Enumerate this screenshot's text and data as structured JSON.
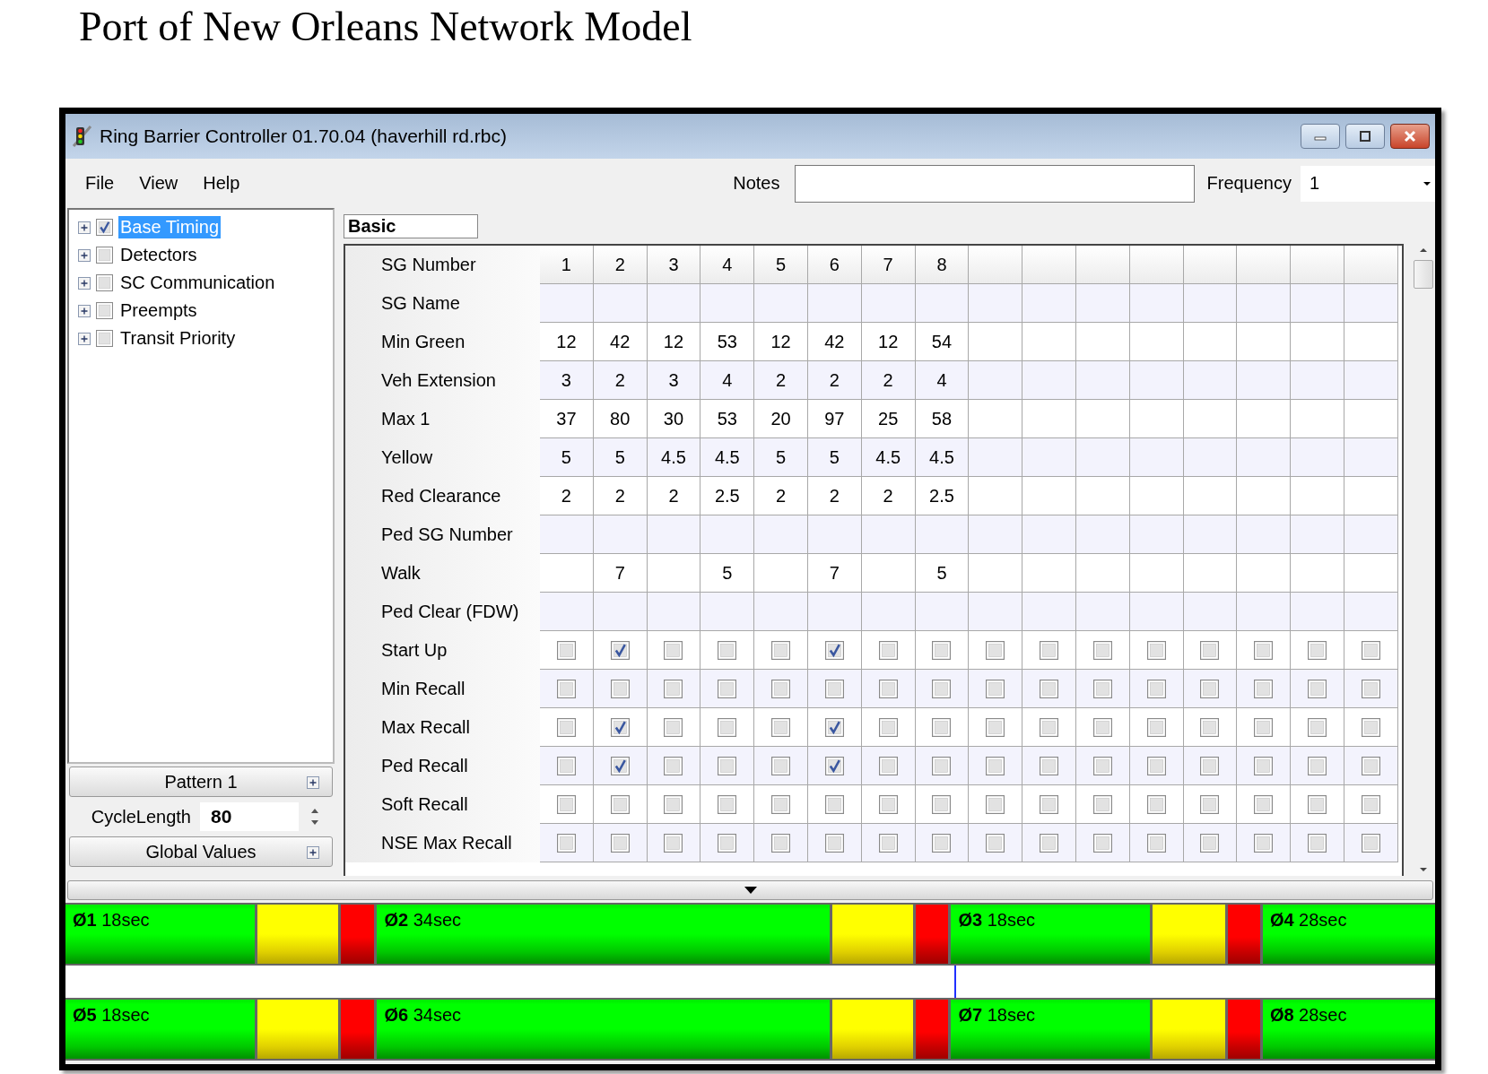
{
  "document_title": "Port of New Orleans Network Model",
  "window": {
    "title": "Ring Barrier Controller 01.70.04 (haverhill rd.rbc)"
  },
  "menu": [
    "File",
    "View",
    "Help"
  ],
  "notes": {
    "label": "Notes"
  },
  "frequency": {
    "label": "Frequency",
    "value": "1"
  },
  "tree": [
    {
      "label": "Base Timing",
      "checked": true,
      "selected": true,
      "expanded": false
    },
    {
      "label": "Detectors",
      "checked": false,
      "selected": false,
      "expanded": false
    },
    {
      "label": "SC Communication",
      "checked": false,
      "selected": false,
      "expanded": false
    },
    {
      "label": "Preempts",
      "checked": false,
      "selected": false,
      "expanded": false
    },
    {
      "label": "Transit Priority",
      "checked": false,
      "selected": false,
      "expanded": false
    }
  ],
  "pattern_button": "Pattern 1",
  "cycle_length": {
    "label": "CycleLength",
    "value": "80"
  },
  "global_values_button": "Global Values",
  "tab": "Basic",
  "grid": {
    "rows": [
      {
        "kind": "header",
        "label": "SG Number",
        "cells": [
          "1",
          "2",
          "3",
          "4",
          "5",
          "6",
          "7",
          "8"
        ]
      },
      {
        "kind": "text",
        "label": "SG Name"
      },
      {
        "kind": "text",
        "label": "Min Green",
        "cells": [
          "12",
          "42",
          "12",
          "53",
          "12",
          "42",
          "12",
          "54"
        ]
      },
      {
        "kind": "text",
        "label": "Veh Extension",
        "cells": [
          "3",
          "2",
          "3",
          "4",
          "2",
          "2",
          "2",
          "4"
        ]
      },
      {
        "kind": "text",
        "label": "Max 1",
        "cells": [
          "37",
          "80",
          "30",
          "53",
          "20",
          "97",
          "25",
          "58"
        ]
      },
      {
        "kind": "text",
        "label": "Yellow",
        "cells": [
          "5",
          "5",
          "4.5",
          "4.5",
          "5",
          "5",
          "4.5",
          "4.5"
        ]
      },
      {
        "kind": "text",
        "label": "Red Clearance",
        "cells": [
          "2",
          "2",
          "2",
          "2.5",
          "2",
          "2",
          "2",
          "2.5"
        ]
      },
      {
        "kind": "text",
        "label": "Ped SG Number"
      },
      {
        "kind": "text",
        "label": "Walk",
        "cells": [
          null,
          "7",
          null,
          "5",
          null,
          "7",
          null,
          "5"
        ]
      },
      {
        "kind": "text",
        "label": "Ped Clear (FDW)"
      },
      {
        "kind": "checkbox",
        "label": "Start Up",
        "checks": [
          false,
          true,
          false,
          false,
          false,
          true,
          false,
          false,
          false,
          false,
          false,
          false,
          false,
          false,
          false,
          false
        ]
      },
      {
        "kind": "checkbox",
        "label": "Min Recall",
        "checks": [
          false,
          false,
          false,
          false,
          false,
          false,
          false,
          false,
          false,
          false,
          false,
          false,
          false,
          false,
          false,
          false
        ]
      },
      {
        "kind": "checkbox",
        "label": "Max Recall",
        "checks": [
          false,
          true,
          false,
          false,
          false,
          true,
          false,
          false,
          false,
          false,
          false,
          false,
          false,
          false,
          false,
          false
        ]
      },
      {
        "kind": "checkbox",
        "label": "Ped Recall",
        "checks": [
          false,
          true,
          false,
          false,
          false,
          true,
          false,
          false,
          false,
          false,
          false,
          false,
          false,
          false,
          false,
          false
        ]
      },
      {
        "kind": "checkbox",
        "label": "Soft Recall",
        "checks": [
          false,
          false,
          false,
          false,
          false,
          false,
          false,
          false,
          false,
          false,
          false,
          false,
          false,
          false,
          false,
          false
        ]
      },
      {
        "kind": "checkbox",
        "label": "NSE Max Recall",
        "checks": [
          false,
          false,
          false,
          false,
          false,
          false,
          false,
          false,
          false,
          false,
          false,
          false,
          false,
          false,
          false,
          false
        ]
      }
    ]
  },
  "rings": [
    {
      "phases": [
        {
          "label": "**Ø1** 18sec"
        },
        {
          "label": "**Ø2** 34sec"
        },
        {
          "label": "**Ø3** 18sec"
        },
        {
          "label": "**Ø4** 28sec"
        }
      ]
    },
    {
      "phases": [
        {
          "label": "**Ø5** 18sec"
        },
        {
          "label": "**Ø6** 34sec"
        },
        {
          "label": "**Ø7** 18sec"
        },
        {
          "label": "**Ø8** 28sec"
        }
      ]
    }
  ]
}
